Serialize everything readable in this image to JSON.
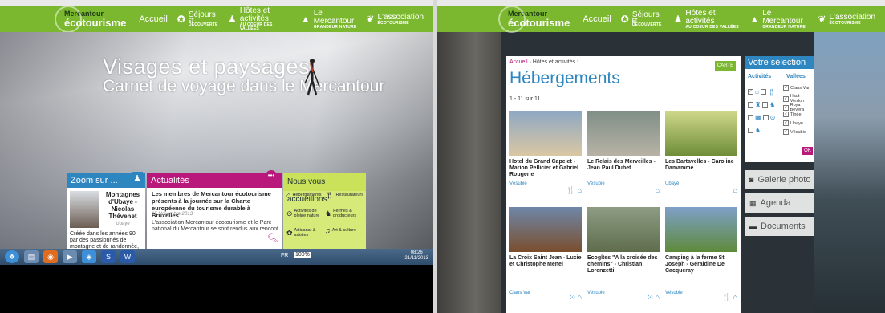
{
  "nav": {
    "logo_top": "Mercantour",
    "logo_main": "écotourisme",
    "accueil": "Accueil",
    "items": [
      {
        "label": "Séjours",
        "sub": "ET DÉCOUVERTE",
        "icon": "compass-icon"
      },
      {
        "label": "Hôtes et activités",
        "sub": "AU COEUR DES VALLÉES",
        "icon": "person-icon"
      },
      {
        "label": "Le Mercantour",
        "sub": "GRANDEUR NATURE",
        "icon": "mountain-icon"
      },
      {
        "label": "L'association",
        "sub": "ÉCOTOURISME",
        "icon": "leaf-icon"
      }
    ]
  },
  "left": {
    "hero_title": "Visages et paysages",
    "hero_sub": "Carnet de voyage dans le Mercantour",
    "zoom": {
      "header": "Zoom sur ...",
      "name": "Montagnes d'Ubaye - Nicolas Thévenet",
      "place": "Ubaye",
      "text": "Créée dans les années 90 par des passionnés de montagne et de randonnée, l'agence"
    },
    "actu": {
      "header": "Actualités",
      "title": "Les membres de Mercantour écotourisme présents à la journée sur la Charte européenne du tourisme durable à Bruxelles",
      "date": "15 Novembre 2013",
      "text": "L'association Mercantour écotourisme et le Parc national du Mercantour se sont rendus aux rencont"
    },
    "accueil": {
      "header": "Nous vous accueillons",
      "items": [
        {
          "label": "Hébergements",
          "icon": "house-icon"
        },
        {
          "label": "Restaurateurs",
          "icon": "cutlery-icon"
        },
        {
          "label": "Activités de pleine nature",
          "icon": "compass-icon"
        },
        {
          "label": "Fermes & producteurs",
          "icon": "cow-icon"
        },
        {
          "label": "Artisanat & artistes",
          "icon": "palette-icon"
        },
        {
          "label": "Art & culture",
          "icon": "music-icon"
        }
      ]
    },
    "taskbar": {
      "lang": "FR",
      "zoom": "100%",
      "time": "08:26",
      "date": "21/11/2013"
    }
  },
  "right": {
    "breadcrumb_home": "Accueil",
    "breadcrumb_rest": " › Hôtes et activités ›",
    "carte": "CARTE",
    "title": "Hébergements",
    "count": "1 - 11 sur 11",
    "tiles": [
      {
        "title": "Hotel du Grand Capelet - Marion Pellicier et Gabriel Rougerie",
        "valley": "Vésubie",
        "icons": "🍴 ⌂",
        "color1": "#8fa8c4",
        "color2": "#d9c7a3"
      },
      {
        "title": "Le Relais des Merveilles - Jean Paul Duhet",
        "valley": "Vésubie",
        "icons": "⌂",
        "color1": "#7f8f86",
        "color2": "#b8b2a6"
      },
      {
        "title": "Les Bartavelles - Caroline Damamme",
        "valley": "Ubaye",
        "icons": "⌂",
        "color1": "#cfd88a",
        "color2": "#6f8d3a"
      },
      {
        "title": "La Croix Saint Jean - Lucie et Christophe Menei",
        "valley": "Cians Var",
        "icons": "⊙ ⌂",
        "color1": "#6f87a8",
        "color2": "#7a4e2d"
      },
      {
        "title": "Ecogîtes \"A la croisée des chemins\" - Christian Lorenzetti",
        "valley": "Vésubie",
        "icons": "⊙ ⌂",
        "color1": "#8d9c83",
        "color2": "#5f6d4d"
      },
      {
        "title": "Camping à la ferme St Joseph - Géraldine De Cacqueray",
        "valley": "Vésubie",
        "icons": "🍴 ⌂",
        "color1": "#7fa0c8",
        "color2": "#5e8a3a"
      }
    ],
    "selection": {
      "header": "Votre sélection",
      "col_activites": "Activités",
      "col_vallees": "Vallées",
      "vallees": [
        "Cians Var",
        "Haut Verdon",
        "Roya Bévéra",
        "Tinée",
        "Ubaye",
        "Vésubie"
      ],
      "ok": "OK"
    },
    "side_buttons": [
      {
        "label": "Galerie photo",
        "icon": "camera-icon",
        "glyph": "◙"
      },
      {
        "label": "Agenda",
        "icon": "calendar-icon",
        "glyph": "▦"
      },
      {
        "label": "Documents",
        "icon": "folder-icon",
        "glyph": "▬"
      }
    ]
  }
}
